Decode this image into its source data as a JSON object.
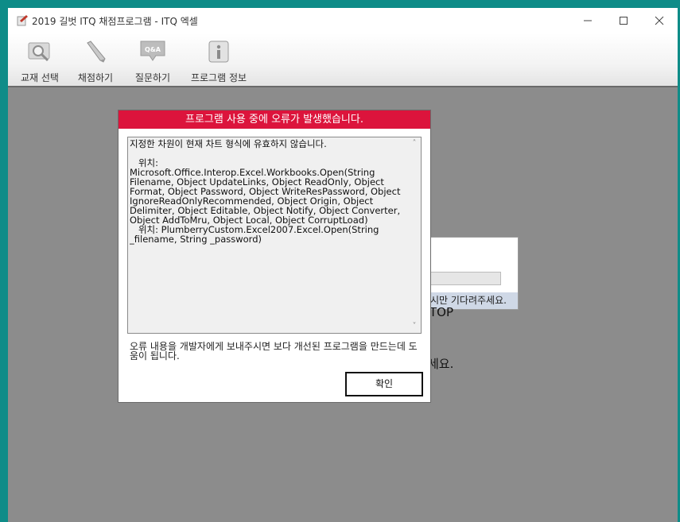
{
  "window": {
    "title": "2019 길벗 ITQ 채점프로그램 - ITQ 엑셀",
    "controls": [
      "minimize-icon",
      "maximize-icon",
      "close-icon"
    ]
  },
  "toolbar": {
    "items": [
      {
        "label": "교재 선택",
        "icon": "book-search-icon"
      },
      {
        "label": "채점하기",
        "icon": "pencil-icon"
      },
      {
        "label": "질문하기",
        "icon": "qa-speech-icon"
      },
      {
        "label": "프로그램 정보",
        "icon": "info-icon"
      }
    ]
  },
  "background": {
    "status_message": "시만 기다려주세요.",
    "text_fragment_1": "TOP",
    "text_fragment_2": "세요."
  },
  "error_dialog": {
    "header": "프로그램 사용 중에 오류가 발생했습니다.",
    "details": "지정한 차원이 현재 차트 형식에 유효하지 않습니다.\n\n   위치: Microsoft.Office.Interop.Excel.Workbooks.Open(String Filename, Object UpdateLinks, Object ReadOnly, Object Format, Object Password, Object WriteResPassword, Object IgnoreReadOnlyRecommended, Object Origin, Object Delimiter, Object Editable, Object Notify, Object Converter, Object AddToMru, Object Local, Object CorruptLoad)\n   위치: PlumberryCustom.Excel2007.Excel.Open(String _filename, String _password)",
    "note": "오류 내용을 개발자에게 보내주시면 보다 개선된 프로그램을 만드는데 도움이 됩니다.",
    "ok_label": "확인",
    "header_color": "#dc143c"
  }
}
